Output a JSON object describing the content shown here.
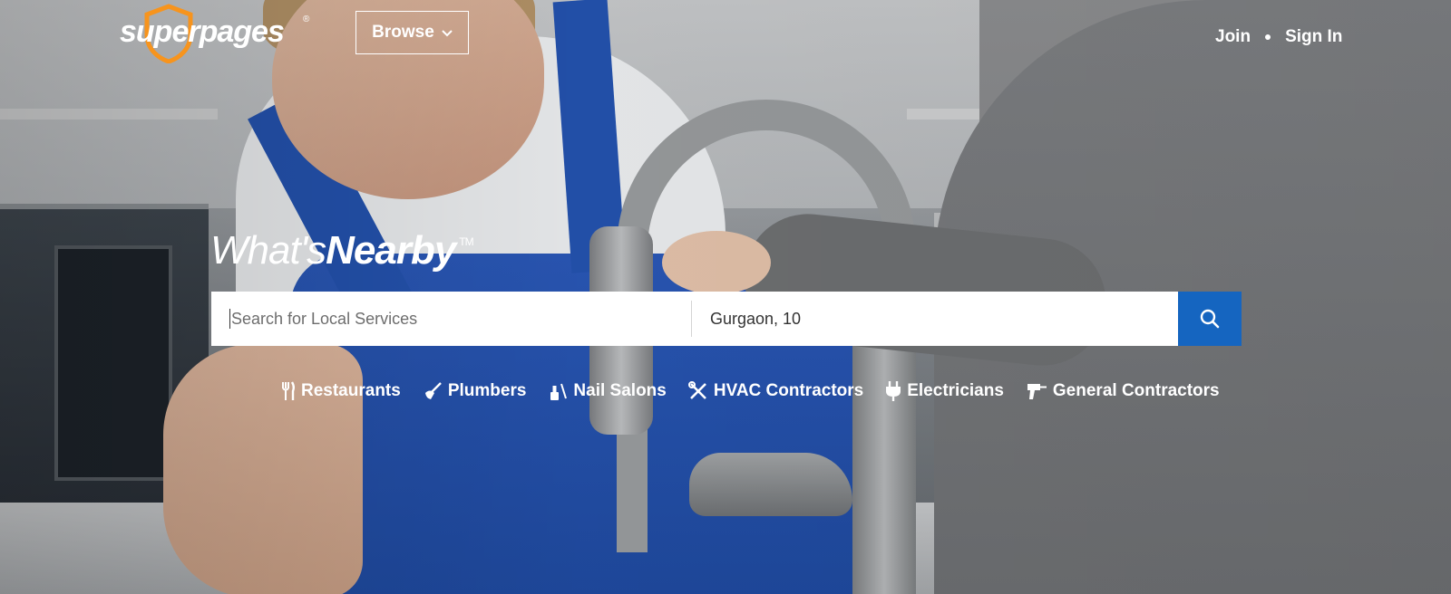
{
  "header": {
    "logo_text": "superpages",
    "logo_registered": "®",
    "browse_label": "Browse",
    "join_label": "Join",
    "signin_label": "Sign In"
  },
  "hero": {
    "tagline_light": "What's",
    "tagline_bold": "Nearby",
    "tagline_tm": "TM"
  },
  "search": {
    "what_placeholder": "Search for Local Services",
    "where_value": "Gurgaon, 10"
  },
  "categories": [
    {
      "label": "Restaurants",
      "icon": "fork-knife-icon"
    },
    {
      "label": "Plumbers",
      "icon": "plunger-icon"
    },
    {
      "label": "Nail Salons",
      "icon": "nail-polish-icon"
    },
    {
      "label": "HVAC Contractors",
      "icon": "wrench-screwdriver-icon"
    },
    {
      "label": "Electricians",
      "icon": "plug-icon"
    },
    {
      "label": "General Contractors",
      "icon": "drill-icon"
    }
  ],
  "colors": {
    "brand_orange": "#f7941d",
    "search_button_blue": "#1565c0",
    "text_white": "#ffffff"
  }
}
